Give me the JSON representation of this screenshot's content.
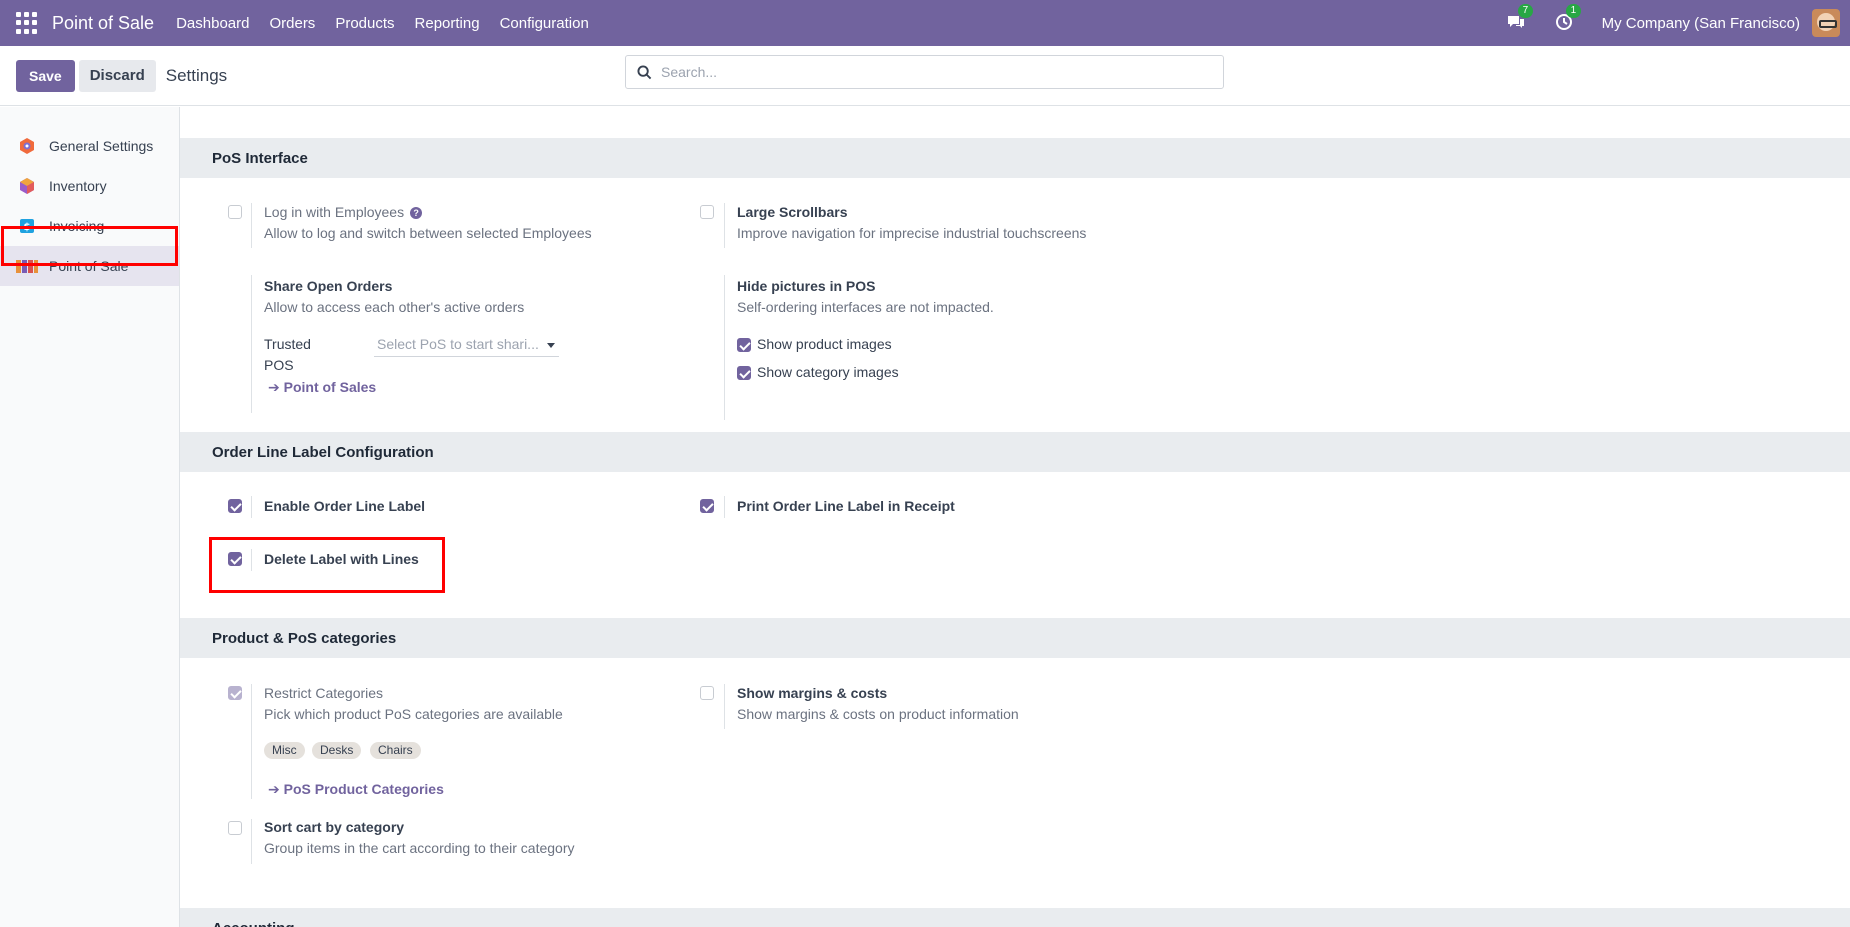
{
  "navbar": {
    "brand": "Point of Sale",
    "menu": [
      "Dashboard",
      "Orders",
      "Products",
      "Reporting",
      "Configuration"
    ],
    "messages_count": "7",
    "activities_count": "1",
    "company": "My Company (San Francisco)"
  },
  "control": {
    "save_label": "Save",
    "discard_label": "Discard",
    "title": "Settings",
    "search_placeholder": "Search..."
  },
  "sidebar": {
    "items": [
      {
        "label": "General Settings",
        "icon": "general-settings-icon"
      },
      {
        "label": "Inventory",
        "icon": "inventory-icon"
      },
      {
        "label": "Invoicing",
        "icon": "invoicing-icon"
      },
      {
        "label": "Point of Sale",
        "icon": "point-of-sale-icon",
        "active": true
      }
    ]
  },
  "sections": {
    "pos_interface": {
      "title": "PoS Interface",
      "login_employees": {
        "title": "Log in with Employees",
        "desc": "Allow to log and switch between selected Employees",
        "checked": false
      },
      "large_scrollbars": {
        "title": "Large Scrollbars",
        "desc": "Improve navigation for imprecise industrial touchscreens",
        "checked": false
      },
      "share_open_orders": {
        "title": "Share Open Orders",
        "desc": "Allow to access each other's active orders",
        "trusted_label_1": "Trusted",
        "trusted_label_2": "POS",
        "select_placeholder": "Select PoS to start shari...",
        "link": "Point of Sales"
      },
      "hide_pictures": {
        "title": "Hide pictures in POS",
        "desc": "Self-ordering interfaces are not impacted.",
        "product_images": "Show product images",
        "category_images": "Show category images"
      }
    },
    "order_line_label": {
      "title": "Order Line Label Configuration",
      "enable": {
        "title": "Enable Order Line Label",
        "checked": true
      },
      "print": {
        "title": "Print Order Line Label in Receipt",
        "checked": true
      },
      "delete": {
        "title": "Delete Label with Lines",
        "checked": true
      }
    },
    "product_categories": {
      "title": "Product & PoS categories",
      "restrict": {
        "title": "Restrict Categories",
        "desc": "Pick which product PoS categories are available",
        "tags": [
          "Misc",
          "Desks",
          "Chairs"
        ],
        "link": "PoS Product Categories"
      },
      "margins": {
        "title": "Show margins & costs",
        "desc": "Show margins & costs on product information"
      },
      "sort_cart": {
        "title": "Sort cart by category",
        "desc": "Group items in the cart according to their category"
      }
    },
    "accounting": {
      "title": "Accounting"
    }
  },
  "colors": {
    "brand": "#71639e",
    "highlight": "#ff0000"
  }
}
